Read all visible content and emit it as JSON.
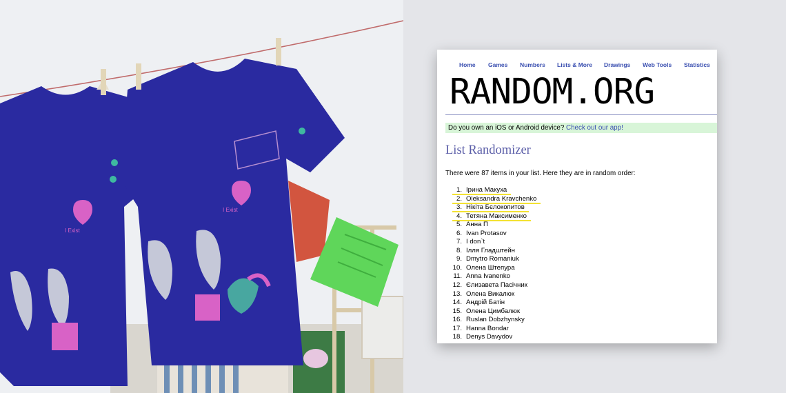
{
  "nav": {
    "items": [
      {
        "label": "Home"
      },
      {
        "label": "Games"
      },
      {
        "label": "Numbers"
      },
      {
        "label": "Lists & More"
      },
      {
        "label": "Drawings"
      },
      {
        "label": "Web Tools"
      },
      {
        "label": "Statistics"
      }
    ]
  },
  "logo": {
    "text": "RANDOM.ORG"
  },
  "promo": {
    "text": "Do you own an iOS or Android device?",
    "link": "Check out our app!"
  },
  "page_title": "List Randomizer",
  "intro": "There were 87 items in your list. Here they are in random order:",
  "list": [
    {
      "n": "1.",
      "name": "Ірина Макуха",
      "highlight": true
    },
    {
      "n": "2.",
      "name": "Oleksandra Kravchenko",
      "highlight": true
    },
    {
      "n": "3.",
      "name": "Нікіта Бєлокопитов",
      "highlight": true
    },
    {
      "n": "4.",
      "name": "Тетяна Максименко",
      "highlight": true
    },
    {
      "n": "5.",
      "name": "Анна П",
      "highlight": false
    },
    {
      "n": "6.",
      "name": "Ivan Protasov",
      "highlight": false
    },
    {
      "n": "7.",
      "name": "I don`t",
      "highlight": false
    },
    {
      "n": "8.",
      "name": "Ілля Гладштейн",
      "highlight": false
    },
    {
      "n": "9.",
      "name": "Dmytro Romaniuk",
      "highlight": false
    },
    {
      "n": "10.",
      "name": "Олена Штепура",
      "highlight": false
    },
    {
      "n": "11.",
      "name": "Anna Ivanenko",
      "highlight": false
    },
    {
      "n": "12.",
      "name": "Єлизавета Пасічник",
      "highlight": false
    },
    {
      "n": "13.",
      "name": "Олена Викалюк",
      "highlight": false
    },
    {
      "n": "14.",
      "name": "Андрій Батін",
      "highlight": false
    },
    {
      "n": "15.",
      "name": "Олена Цимбалюк",
      "highlight": false
    },
    {
      "n": "16.",
      "name": "Ruslan Dobzhynsky",
      "highlight": false
    },
    {
      "n": "17.",
      "name": "Hanna Bondar",
      "highlight": false
    },
    {
      "n": "18.",
      "name": "Denys Davydov",
      "highlight": false
    }
  ],
  "photo": {
    "shirt_slogan": "I Exist",
    "colors": {
      "shirt": "#2a2aa0",
      "pink": "#d862c6",
      "flag_red": "#d2553f",
      "flag_green": "#5fd65a"
    }
  },
  "colors": {
    "link": "#3a4fb0",
    "heading": "#5b5ea8",
    "promo_bg": "#d8f5d8",
    "highlight": "#f3e233"
  }
}
